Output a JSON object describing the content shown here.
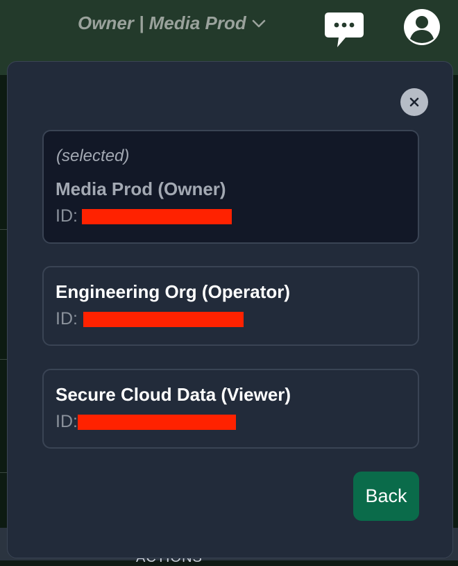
{
  "header": {
    "org_switch_label": "Owner | Media Prod",
    "chat_icon": "chat-bubble-icon",
    "avatar_icon": "user-avatar-icon"
  },
  "background": {
    "bottom_label": "ACTIONS"
  },
  "modal": {
    "close_icon": "close-icon",
    "orgs": [
      {
        "note": "(selected)",
        "name": "Media Prod (Owner)",
        "id_label": "ID:",
        "selected": true
      },
      {
        "note": "",
        "name": "Engineering Org (Operator)",
        "id_label": "ID:",
        "selected": false
      },
      {
        "note": "",
        "name": "Secure Cloud Data (Viewer)",
        "id_label": "ID:",
        "selected": false
      }
    ],
    "back_label": "Back"
  },
  "colors": {
    "header_bg": "#233a2b",
    "modal_bg": "#222b3a",
    "selected_card_bg": "#121827",
    "back_button": "#0a6b4a",
    "redaction": "#ff2200"
  }
}
